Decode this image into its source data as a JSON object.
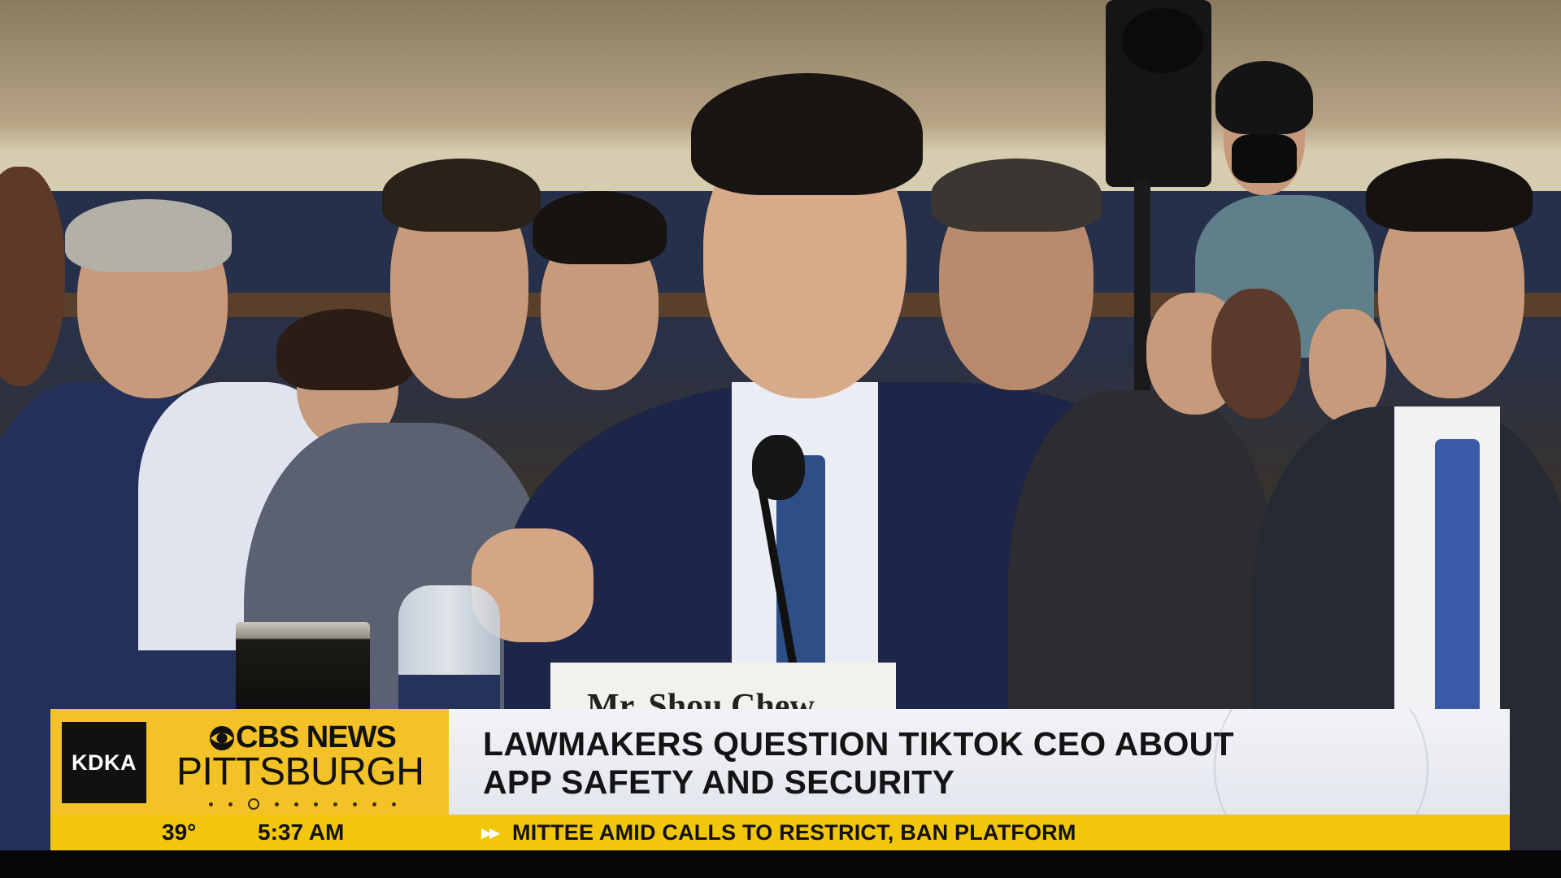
{
  "channel": {
    "station": "KDKA",
    "network": "CBS NEWS",
    "city": "PITTSBURGH",
    "page_indicator": {
      "total": 10,
      "active": 3
    }
  },
  "headline": {
    "line1": "LAWMAKERS QUESTION TIKTOK CEO ABOUT",
    "line2": "APP SAFETY AND SECURITY"
  },
  "ticker": {
    "temperature": "39°",
    "time": "5:37 AM",
    "arrow": "▶▶",
    "text": "MITTEE AMID CALLS TO RESTRICT, BAN PLATFORM"
  },
  "scene": {
    "nameplate": "Mr. Shou Chew"
  },
  "colors": {
    "brand_yellow": "#f2c227",
    "ticker_yellow": "#f2c60a",
    "headline_bg": "#eceef4",
    "kdka_bg": "#111111"
  },
  "icons": {
    "cbs_eye": "eye-icon"
  }
}
